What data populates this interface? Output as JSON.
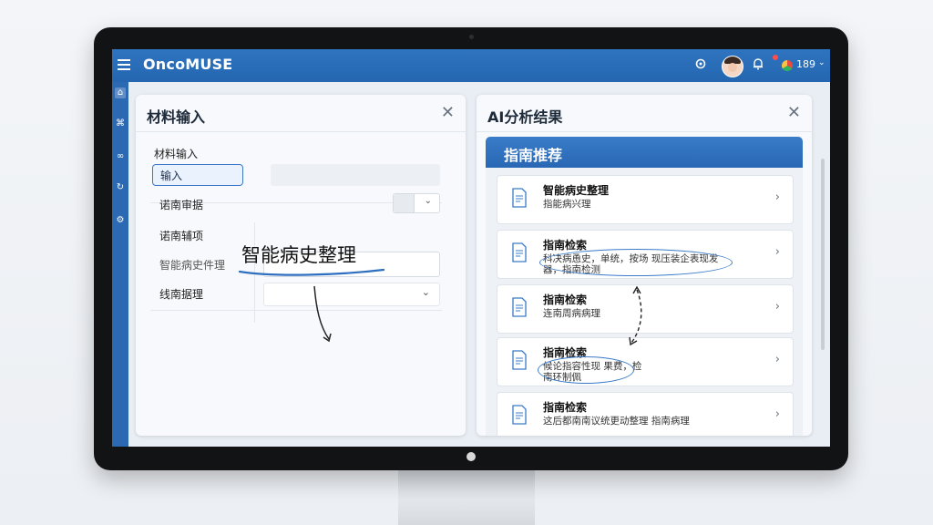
{
  "app": {
    "title": "OncoMUSE"
  },
  "topbar": {
    "user_code": "189",
    "chevron": "⌄"
  },
  "left_panel": {
    "title": "材料输入",
    "subtitle": "材料输入",
    "tab_input": "输入",
    "rows": [
      "诺南审据",
      "诺南辅项",
      "智能病史件理",
      "线南据理"
    ],
    "handwritten_title": "智能病史整理"
  },
  "right_panel": {
    "title": "AI分析结果",
    "section_title": "指南推荐",
    "cards": [
      {
        "title": "智能病史整理",
        "subtitle": "指能病兴理"
      },
      {
        "title": "指南检索",
        "subtitle": "科决病恿史，单统，按场 现压装企表现发器，指南检测"
      },
      {
        "title": "指南检索",
        "subtitle": "连南周病病理"
      },
      {
        "title": "指南检索",
        "subtitle": "候论指容性现 果费，检南环制佩"
      },
      {
        "title": "指南检索",
        "subtitle": "这后都南南议统更动整理 指南病理"
      }
    ]
  },
  "colors": {
    "brand": "#2466b0",
    "accent": "#3a7cc8"
  },
  "icons": [
    "menu-icon",
    "settings-icon",
    "avatar",
    "bell-icon",
    "status-icon",
    "home-icon",
    "chart-icon",
    "link-icon",
    "share-icon",
    "settings-gear-icon",
    "close-icon",
    "document-icon",
    "chevron-right-icon"
  ]
}
